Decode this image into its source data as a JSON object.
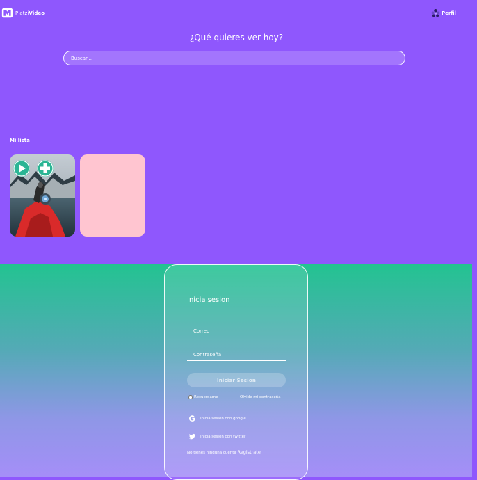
{
  "header": {
    "brand_prefix": "Platzi",
    "brand_suffix": "Video",
    "profile_label": "Perfil"
  },
  "hero": {
    "title": "¿Qué quieres ver hoy?",
    "search_placeholder": "Buscar..."
  },
  "my_list": {
    "title": "Mi lista"
  },
  "login": {
    "title": "Inicia sesion",
    "email_placeholder": "Correo",
    "password_placeholder": "Contraseña",
    "submit_label": "Iniciar Sesion",
    "remember_label": "Recuerdame",
    "forgot_label": "Olvide mi contraseña",
    "google_label": "Inicia sesion con google",
    "twitter_label": "Inicia sesion con twitter",
    "register_prompt": "No tienes ninguna cuenta",
    "register_link": "Registrate"
  },
  "colors": {
    "background": "#8f57fd",
    "accent": "#2bb594",
    "placeholder_card": "#ffc5d0"
  },
  "icons": [
    "platzi-video-logo-icon",
    "profile-icon",
    "play-icon",
    "add-icon",
    "google-icon",
    "twitter-icon"
  ]
}
